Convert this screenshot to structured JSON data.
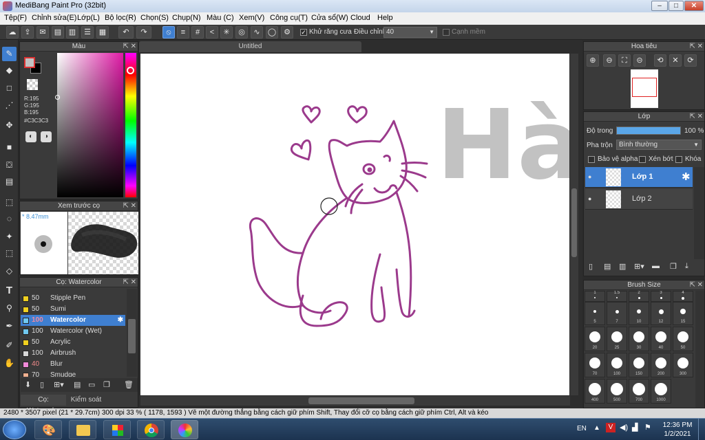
{
  "window": {
    "title": "MediBang Paint Pro (32bit)",
    "min": "–",
    "max": "□",
    "close": "✕"
  },
  "menu": [
    "Tệp(F)",
    "Chỉnh sửa(E)",
    "Lớp(L)",
    "Bộ lọc(R)",
    "Chọn(S)",
    "Chụp(N)",
    "Màu (C)",
    "Xem(V)",
    "Công cụ(T)",
    "Cửa sổ(W)",
    "Cloud",
    "Help"
  ],
  "toolbar": {
    "antialias_label": "Khử răng cưa",
    "antialias_checked": true,
    "adjust_label": "Điều chỉnh",
    "adjust_value": "40",
    "soft_edge_label": "Cạnh mềm",
    "soft_edge_checked": false
  },
  "color_panel": {
    "title": "Màu",
    "r": "R:195",
    "g": "G:195",
    "b": "B:195",
    "hex": "#C3C3C3",
    "fg": "#C3C3C3",
    "bg": "#000000"
  },
  "brush_preview": {
    "title": "Xem trước cọ",
    "size": "* 8.47mm"
  },
  "brush_panel": {
    "title": "Cọ: Watercolor",
    "brushes": [
      {
        "size": "50",
        "name": "Stipple Pen",
        "color": "#f0d020"
      },
      {
        "size": "50",
        "name": "Sumi",
        "color": "#f0d020"
      },
      {
        "size": "100",
        "name": "Watercolor",
        "color": "#70c8f0",
        "selected": true
      },
      {
        "size": "100",
        "name": "Watercolor (Wet)",
        "color": "#70c8f0"
      },
      {
        "size": "50",
        "name": "Acrylic",
        "color": "#f0d020"
      },
      {
        "size": "100",
        "name": "Airbrush",
        "color": "#d8d8d8"
      },
      {
        "size": "40",
        "name": "Blur",
        "color": "#f08ad8"
      },
      {
        "size": "70",
        "name": "Smudge",
        "color": "#f0b090"
      }
    ],
    "tabs": [
      "Cọ: Watercolor",
      "Kiểm soát cọ"
    ]
  },
  "document": {
    "tab": "Untitled",
    "canvas_text": "Hà"
  },
  "navigator": {
    "title": "Hoa tiêu"
  },
  "layers": {
    "title": "Lớp",
    "opacity_label": "Độ trong",
    "opacity_value": "100 %",
    "opacity": 1.0,
    "blend_label": "Pha trộn",
    "blend_value": "Bình thường",
    "protect_alpha": "Bảo vệ alpha",
    "clipping": "Xén bớt",
    "lock": "Khóa",
    "items": [
      {
        "name": "Lớp 1",
        "selected": true
      },
      {
        "name": "Lớp 2",
        "selected": false
      }
    ]
  },
  "brush_size": {
    "title": "Brush Size",
    "sizes": [
      "1",
      "1.5",
      "2",
      "3",
      "4",
      "5",
      "7",
      "10",
      "12",
      "15",
      "20",
      "25",
      "30",
      "40",
      "50",
      "70",
      "100",
      "150",
      "200",
      "300",
      "400",
      "500",
      "700",
      "1000"
    ]
  },
  "status": {
    "text": "2480 * 3507 pixel   (21 * 29.7cm)   300 dpi   33 %   ( 1178, 1593 )   Vẽ một đường thẳng bằng cách giữ phím Shift, Thay đổi cỡ cọ bằng cách giữ phím Ctrl, Alt và kéo"
  },
  "taskbar": {
    "lang": "EN",
    "time": "12:36 PM",
    "date": "1/2/2021"
  }
}
